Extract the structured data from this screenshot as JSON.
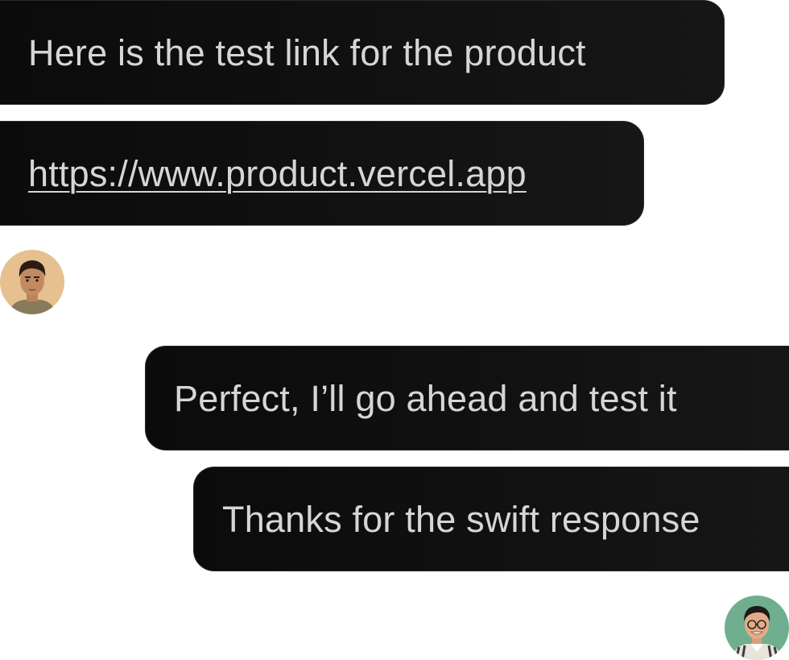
{
  "messages": [
    {
      "text": "Here is the test link for the product",
      "sender": "contact"
    },
    {
      "text": "https://www.product.vercel.app",
      "sender": "contact",
      "is_link": true
    },
    {
      "text": "Perfect, I’ll go ahead and test it",
      "sender": "user"
    },
    {
      "text": "Thanks for the swift response",
      "sender": "user"
    }
  ],
  "avatars": {
    "contact": {
      "icon": "contact-avatar",
      "background": "#e6c08f"
    },
    "user": {
      "icon": "user-avatar",
      "background": "#6fae8e"
    }
  },
  "colors": {
    "bubble_background": "#111111",
    "bubble_text": "#d6d6d6",
    "page_background": "#ffffff"
  }
}
